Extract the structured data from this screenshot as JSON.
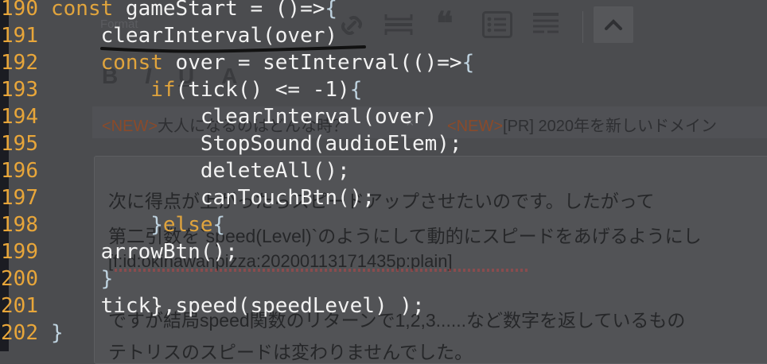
{
  "editor": {
    "format_label": "Format",
    "format_buttons": [
      "B",
      "I",
      "U",
      "A"
    ],
    "tags": [
      {
        "new": "<NEW>",
        "text": "大人になるのはどんな時？"
      },
      {
        "new": "<NEW>",
        "text": "[PR] 2020年を新しいドメイン"
      }
    ],
    "tag_close": "×",
    "body_lines": [
      "次に得点が上がったらスピードアップさせたいのです。したがって",
      "第二引数を`speed(Level)`のようにして動的にスピードをあげるようにし",
      "[f:id:okinawanpizza:20200113171435p:plain]",
      "ですが結局speed関数のリターンで1,2,3......など数字を返しているもの",
      "テトリスのスピードは変わりませんでした。"
    ]
  },
  "code": {
    "line_numbers": [
      "190",
      "191",
      "192",
      "193",
      "194",
      "195",
      "196",
      "197",
      "198",
      "199",
      "200",
      "201",
      "202"
    ],
    "l190": {
      "kw": "const",
      "rest": " gameStart = ()=>",
      "brace": "{"
    },
    "l191": {
      "text": "    clearInterval(over)"
    },
    "l192": {
      "indent": "    ",
      "kw": "const",
      "rest": " over = setInterval(()=>",
      "brace": "{"
    },
    "l193": {
      "indent": "        ",
      "kw": "if",
      "rest": "(tick() <= -1)",
      "brace": "{"
    },
    "l194": {
      "text": "            clearInterval(over)"
    },
    "l195": {
      "text": "            StopSound(audioElem);"
    },
    "l196": {
      "text": "            deleteAll();"
    },
    "l197": {
      "text": "            canTouchBtn();"
    },
    "l198": {
      "indent": "        ",
      "brace1": "}",
      "kw": "else",
      "brace2": "{"
    },
    "l199": {
      "text": "    arrowBtn();"
    },
    "l200": {
      "indent": "    ",
      "brace": "}"
    },
    "l201": {
      "text": "    tick},speed(speedLevel) );"
    },
    "l202": {
      "brace": "}"
    }
  },
  "colors": {
    "keyword": "#e0a43d",
    "line_number": "#e8a63a",
    "code_text": "#f2f2f2",
    "underline": "#111111"
  }
}
